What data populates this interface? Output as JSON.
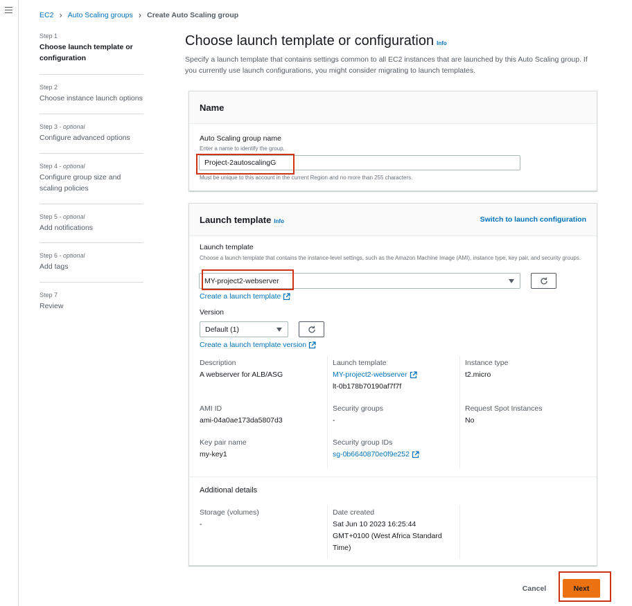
{
  "breadcrumb": {
    "ec2": "EC2",
    "asg": "Auto Scaling groups",
    "current": "Create Auto Scaling group"
  },
  "steps": [
    {
      "num": "Step 1",
      "optional": "",
      "title": "Choose launch template or configuration"
    },
    {
      "num": "Step 2",
      "optional": "",
      "title": "Choose instance launch options"
    },
    {
      "num": "Step 3 - ",
      "optional": "optional",
      "title": "Configure advanced options"
    },
    {
      "num": "Step 4 - ",
      "optional": "optional",
      "title": "Configure group size and scaling policies"
    },
    {
      "num": "Step 5 - ",
      "optional": "optional",
      "title": "Add notifications"
    },
    {
      "num": "Step 6 - ",
      "optional": "optional",
      "title": "Add tags"
    },
    {
      "num": "Step 7",
      "optional": "",
      "title": "Review"
    }
  ],
  "page": {
    "title": "Choose launch template or configuration",
    "info": "Info",
    "description": "Specify a launch template that contains settings common to all EC2 instances that are launched by this Auto Scaling group. If you currently use launch configurations, you might consider migrating to launch templates."
  },
  "name_panel": {
    "heading": "Name",
    "label": "Auto Scaling group name",
    "help": "Enter a name to identify the group.",
    "value": "Project-2autoscalingG",
    "constraint": "Must be unique to this account in the current Region and no more than 255 characters."
  },
  "lt_panel": {
    "heading": "Launch template",
    "info": "Info",
    "switch_label": "Switch to launch configuration",
    "lt_label": "Launch template",
    "lt_help": "Choose a launch template that contains the instance-level settings, such as the Amazon Machine Image (AMI), instance type, key pair, and security groups.",
    "lt_selected": "MY-project2-webserver",
    "create_lt_link": "Create a launch template",
    "version_label": "Version",
    "version_selected": "Default (1)",
    "create_version_link": "Create a launch template version",
    "details": {
      "description_key": "Description",
      "description_val": "A webserver for ALB/ASG",
      "lt_key": "Launch template",
      "lt_val": "MY-project2-webserver",
      "lt_id": "lt-0b178b70190af7f7f",
      "instance_type_key": "Instance type",
      "instance_type_val": "t2.micro",
      "ami_key": "AMI ID",
      "ami_val": "ami-04a0ae173da5807d3",
      "sg_key": "Security groups",
      "sg_val": "-",
      "spot_key": "Request Spot Instances",
      "spot_val": "No",
      "keypair_key": "Key pair name",
      "keypair_val": "my-key1",
      "sgid_key": "Security group IDs",
      "sgid_val": "sg-0b6640870e0f9e252"
    },
    "additional": {
      "heading": "Additional details",
      "storage_key": "Storage (volumes)",
      "storage_val": "-",
      "date_key": "Date created",
      "date_line1": "Sat Jun 10 2023 16:25:44",
      "date_line2": "GMT+0100 (West Africa Standard",
      "date_line3": "Time)"
    }
  },
  "footer": {
    "cancel": "Cancel",
    "next": "Next"
  },
  "colors": {
    "link": "#0073bb",
    "primary_button": "#ec7211",
    "highlight": "#d13212"
  }
}
